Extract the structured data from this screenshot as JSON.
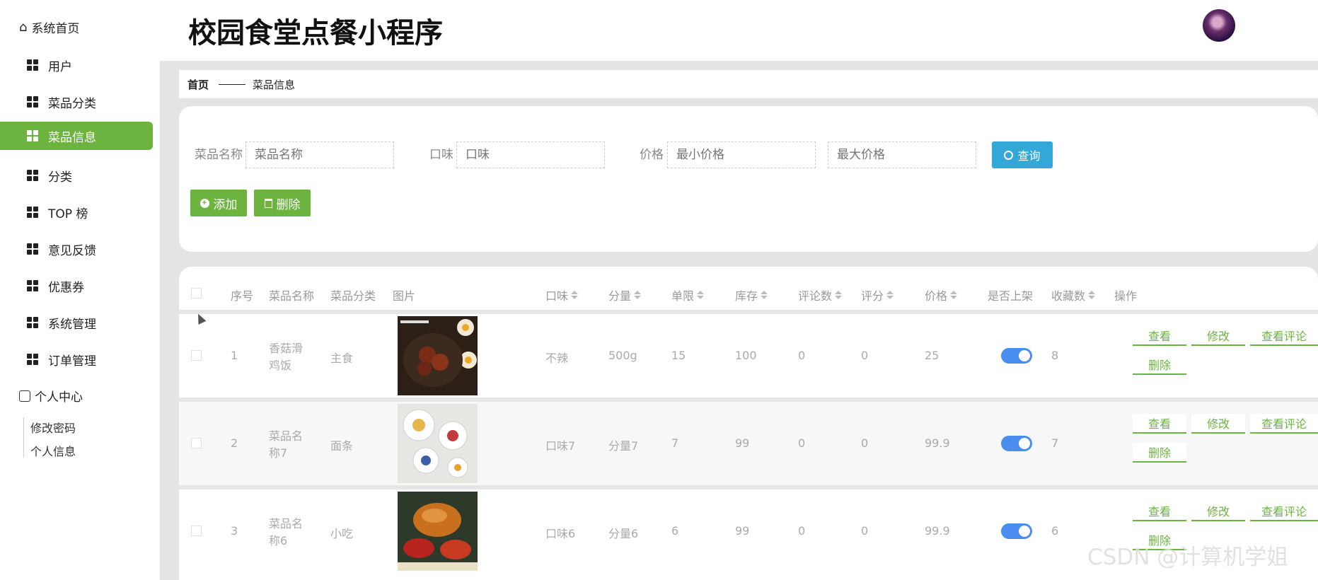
{
  "app": {
    "title": "校园食堂点餐小程序"
  },
  "sidebar": {
    "home": "系统首页",
    "items": [
      {
        "label": "用户",
        "icon": "grid-icon",
        "active": false
      },
      {
        "label": "菜品分类",
        "icon": "clipboard-icon",
        "active": false
      },
      {
        "label": "菜品信息",
        "icon": "chat-icon",
        "active": true
      },
      {
        "label": "分类",
        "icon": "grid-icon",
        "active": false
      },
      {
        "label": "TOP 榜",
        "icon": "grid-icon",
        "active": false
      },
      {
        "label": "意见反馈",
        "icon": "grid-icon",
        "active": false
      },
      {
        "label": "优惠券",
        "icon": "ticket-icon",
        "active": false
      },
      {
        "label": "系统管理",
        "icon": "clipboard-check-icon",
        "active": false
      },
      {
        "label": "订单管理",
        "icon": "grid-icon",
        "active": false
      }
    ],
    "personal": "个人中心",
    "personal_sub": [
      "修改密码",
      "个人信息"
    ]
  },
  "breadcrumb": {
    "home": "首页",
    "current": "菜品信息"
  },
  "search": {
    "name_label": "菜品名称",
    "name_placeholder": "菜品名称",
    "taste_label": "口味",
    "taste_placeholder": "口味",
    "price_label": "价格",
    "min_placeholder": "最小价格",
    "max_placeholder": "最大价格",
    "query_label": "查询",
    "add_label": "添加",
    "delete_label": "删除"
  },
  "table": {
    "headers": [
      "序号",
      "菜品名称",
      "菜品分类",
      "图片",
      "口味",
      "分量",
      "单限",
      "库存",
      "评论数",
      "评分",
      "价格",
      "是否上架",
      "收藏数",
      "操作"
    ],
    "rows": [
      {
        "index": "1",
        "name": "香菇滑鸡饭",
        "category": "主食",
        "taste": "不辣",
        "portion": "500g",
        "limit": "15",
        "stock": "100",
        "comments": "0",
        "rating": "0",
        "price": "25",
        "on_shelf": true,
        "favorites": "8"
      },
      {
        "index": "2",
        "name": "菜品名称7",
        "category": "面条",
        "taste": "口味7",
        "portion": "分量7",
        "limit": "7",
        "stock": "99",
        "comments": "0",
        "rating": "0",
        "price": "99.9",
        "on_shelf": true,
        "favorites": "7"
      },
      {
        "index": "3",
        "name": "菜品名称6",
        "category": "小吃",
        "taste": "口味6",
        "portion": "分量6",
        "limit": "6",
        "stock": "99",
        "comments": "0",
        "rating": "0",
        "price": "99.9",
        "on_shelf": true,
        "favorites": "6"
      }
    ],
    "actions": {
      "view": "查看",
      "edit": "修改",
      "comments": "查看评论",
      "delete": "删除"
    }
  },
  "watermark": "CSDN @计算机学姐",
  "colors": {
    "primary_green": "#6db33f",
    "query_blue": "#32a7d8",
    "switch_blue": "#4a8df0"
  }
}
